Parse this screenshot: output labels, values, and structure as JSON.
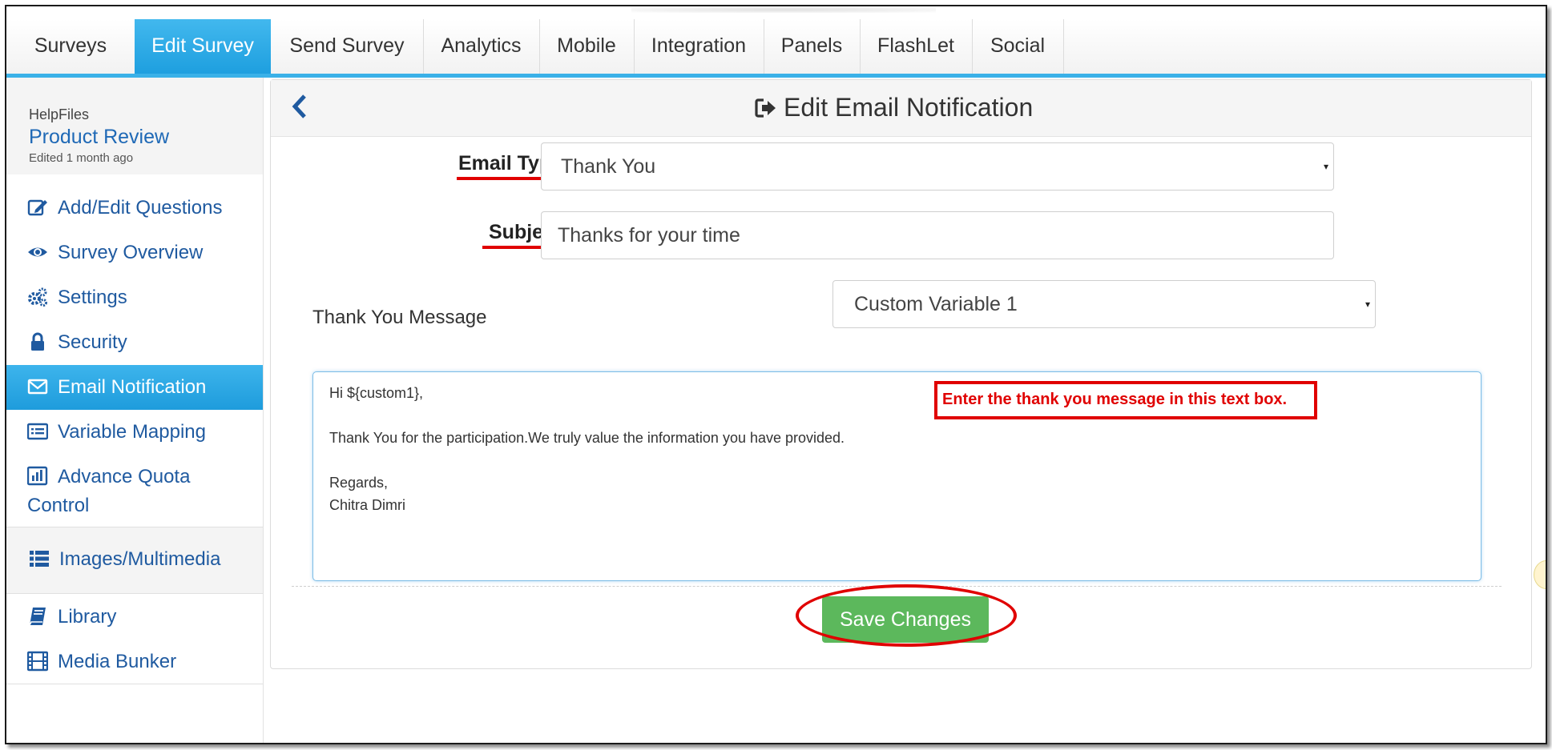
{
  "tabs": [
    {
      "label": "Surveys",
      "active": false
    },
    {
      "label": "Edit Survey",
      "active": true
    },
    {
      "label": "Send Survey",
      "active": false
    },
    {
      "label": "Analytics",
      "active": false
    },
    {
      "label": "Mobile",
      "active": false
    },
    {
      "label": "Integration",
      "active": false
    },
    {
      "label": "Panels",
      "active": false
    },
    {
      "label": "FlashLet",
      "active": false
    },
    {
      "label": "Social",
      "active": false
    }
  ],
  "sidebar": {
    "folder": "HelpFiles",
    "survey_title": "Product Review",
    "edited": "Edited 1 month ago",
    "items": [
      {
        "label": "Add/Edit Questions",
        "icon": "edit-icon"
      },
      {
        "label": "Survey Overview",
        "icon": "eye-icon"
      },
      {
        "label": "Settings",
        "icon": "gears-icon"
      },
      {
        "label": "Security",
        "icon": "lock-icon"
      },
      {
        "label": "Email Notification",
        "icon": "envelope-icon",
        "active": true
      },
      {
        "label": "Variable Mapping",
        "icon": "list-icon"
      },
      {
        "label": "Advance Quota",
        "label2": "Control",
        "icon": "bar-chart-icon"
      },
      {
        "label": "Images/Multimedia",
        "icon": "list-bullets-icon"
      },
      {
        "label": "Library",
        "icon": "book-icon"
      },
      {
        "label": "Media Bunker",
        "icon": "film-icon"
      }
    ]
  },
  "panel": {
    "title": "Edit Email Notification",
    "email_type_label": "Email Type",
    "email_type_value": "Thank You",
    "subject_label": "Subject",
    "subject_value": "Thanks for your time",
    "message_label": "Thank You Message",
    "variable_select_value": "Custom Variable 1",
    "message_lines": [
      "Hi ${custom1},",
      "",
      "Thank You for the participation.We truly value the information you have provided.",
      "",
      "Regards,",
      "Chitra Dimri"
    ],
    "hint": "Enter the thank you message in this text box.",
    "save_label": "Save Changes"
  },
  "colors": {
    "accent": "#3ab1e8",
    "link": "#1f5aa0",
    "save": "#5cb85c",
    "annotation": "#e00000"
  }
}
